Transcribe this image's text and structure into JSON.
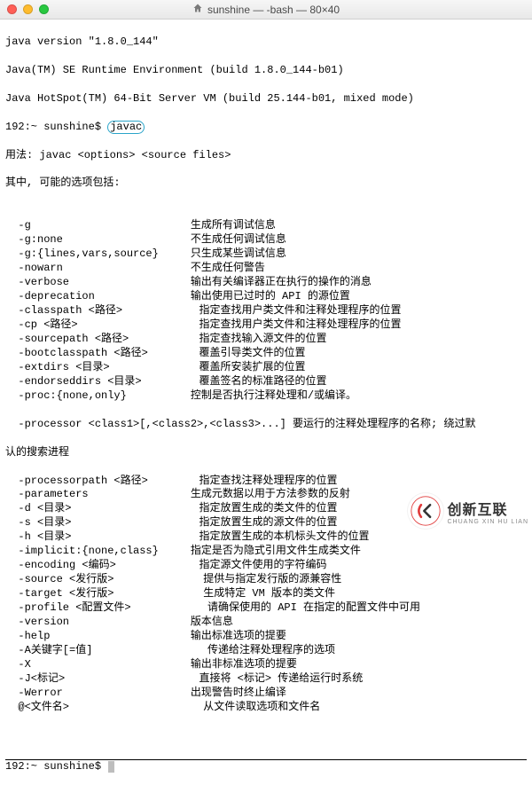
{
  "window": {
    "title": "sunshine — -bash — 80×40"
  },
  "version_lines": [
    "java version \"1.8.0_144\"",
    "Java(TM) SE Runtime Environment (build 1.8.0_144-b01)",
    "Java HotSpot(TM) 64-Bit Server VM (build 25.144-b01, mixed mode)"
  ],
  "prompt1_prefix": "192:~ sunshine$",
  "prompt1_cmd": "javac",
  "usage_line": "用法: javac <options> <source files>",
  "subhead": "其中, 可能的选项包括:",
  "options_before_wrap": [
    {
      "opt": "  -g                         ",
      "desc": "生成所有调试信息"
    },
    {
      "opt": "  -g:none                    ",
      "desc": "不生成任何调试信息"
    },
    {
      "opt": "  -g:{lines,vars,source}     ",
      "desc": "只生成某些调试信息"
    },
    {
      "opt": "  -nowarn                    ",
      "desc": "不生成任何警告"
    },
    {
      "opt": "  -verbose                   ",
      "desc": "输出有关编译器正在执行的操作的消息"
    },
    {
      "opt": "  -deprecation               ",
      "desc": "输出使用已过时的 API 的源位置"
    },
    {
      "opt": "  -classpath <路径>            ",
      "desc": "指定查找用户类文件和注释处理程序的位置"
    },
    {
      "opt": "  -cp <路径>                   ",
      "desc": "指定查找用户类文件和注释处理程序的位置"
    },
    {
      "opt": "  -sourcepath <路径>           ",
      "desc": "指定查找输入源文件的位置"
    },
    {
      "opt": "  -bootclasspath <路径>        ",
      "desc": "覆盖引导类文件的位置"
    },
    {
      "opt": "  -extdirs <目录>              ",
      "desc": "覆盖所安装扩展的位置"
    },
    {
      "opt": "  -endorseddirs <目录>         ",
      "desc": "覆盖签名的标准路径的位置"
    },
    {
      "opt": "  -proc:{none,only}          ",
      "desc": "控制是否执行注释处理和/或编译。"
    }
  ],
  "processor_line1": "  -processor <class1>[,<class2>,<class3>...] 要运行的注释处理程序的名称; 绕过默",
  "processor_line2": "认的搜索进程",
  "options_after_wrap": [
    {
      "opt": "  -processorpath <路径>        ",
      "desc": "指定查找注释处理程序的位置"
    },
    {
      "opt": "  -parameters                ",
      "desc": "生成元数据以用于方法参数的反射"
    },
    {
      "opt": "  -d <目录>                    ",
      "desc": "指定放置生成的类文件的位置"
    },
    {
      "opt": "  -s <目录>                    ",
      "desc": "指定放置生成的源文件的位置"
    },
    {
      "opt": "  -h <目录>                    ",
      "desc": "指定放置生成的本机标头文件的位置"
    },
    {
      "opt": "  -implicit:{none,class}     ",
      "desc": "指定是否为隐式引用文件生成类文件"
    },
    {
      "opt": "  -encoding <编码>             ",
      "desc": "指定源文件使用的字符编码"
    },
    {
      "opt": "  -source <发行版>              ",
      "desc": "提供与指定发行版的源兼容性"
    },
    {
      "opt": "  -target <发行版>              ",
      "desc": "生成特定 VM 版本的类文件"
    },
    {
      "opt": "  -profile <配置文件>            ",
      "desc": "请确保使用的 API 在指定的配置文件中可用"
    },
    {
      "opt": "  -version                   ",
      "desc": "版本信息"
    },
    {
      "opt": "  -help                      ",
      "desc": "输出标准选项的提要"
    },
    {
      "opt": "  -A关键字[=值]                  ",
      "desc": "传递给注释处理程序的选项"
    },
    {
      "opt": "  -X                         ",
      "desc": "输出非标准选项的提要"
    },
    {
      "opt": "  -J<标记>                     ",
      "desc": "直接将 <标记> 传递给运行时系统"
    },
    {
      "opt": "  -Werror                    ",
      "desc": "出现警告时终止编译"
    },
    {
      "opt": "  @<文件名>                     ",
      "desc": "从文件读取选项和文件名"
    }
  ],
  "prompt2": "192:~ sunshine$ ",
  "watermark": {
    "brand": "创新互联",
    "sub": "CHUANG XIN HU LIAN"
  }
}
